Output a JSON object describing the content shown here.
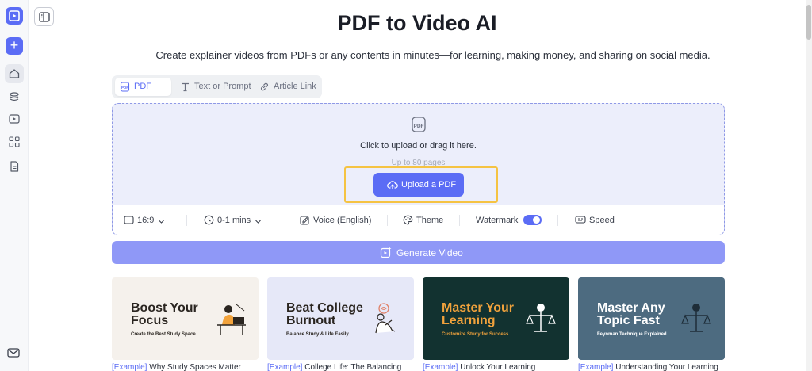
{
  "page": {
    "title": "PDF to Video AI",
    "subtitle": "Create explainer videos from PDFs or any contents in minutes—for learning, making money, and sharing on social media."
  },
  "sidebar": {
    "icons": [
      "logo-icon",
      "plus-icon",
      "home-icon",
      "layers-icon",
      "video-icon",
      "grid-icon",
      "document-icon",
      "mail-icon"
    ]
  },
  "tabs": [
    {
      "label": "PDF",
      "active": true
    },
    {
      "label": "Text or Prompt",
      "active": false
    },
    {
      "label": "Article Link",
      "active": false
    }
  ],
  "upload": {
    "instruction": "Click to upload or drag it here.",
    "limit": "Up to 80 pages",
    "button_label": "Upload a PDF"
  },
  "options": {
    "aspect_ratio": "16:9",
    "duration": "0-1 mins",
    "voice": "Voice (English)",
    "theme": "Theme",
    "watermark": "Watermark",
    "watermark_on": true,
    "speed": "Speed"
  },
  "generate_label": "Generate Video",
  "examples": [
    {
      "title": "Boost Your Focus",
      "subtitle": "Create the Best Study Space",
      "tag": "[Example]",
      "caption": "Why Study Spaces Matter"
    },
    {
      "title": "Beat College Burnout",
      "subtitle": "Balance Study & Life Easily",
      "tag": "[Example]",
      "caption": "College Life: The Balancing"
    },
    {
      "title": "Master Your Learning",
      "subtitle": "Customize Study for Success",
      "tag": "[Example]",
      "caption": "Unlock Your Learning"
    },
    {
      "title": "Master Any Topic Fast",
      "subtitle": "Feynman Technique Explained",
      "tag": "[Example]",
      "caption": "Understanding Your Learning"
    }
  ],
  "colors": {
    "accent": "#5b6cf5",
    "highlight": "#f5c343",
    "card1_bg": "#f5f1ec",
    "card2_bg": "#e6e8f8",
    "card3_bg": "#123230",
    "card4_bg": "#4d6b80"
  }
}
